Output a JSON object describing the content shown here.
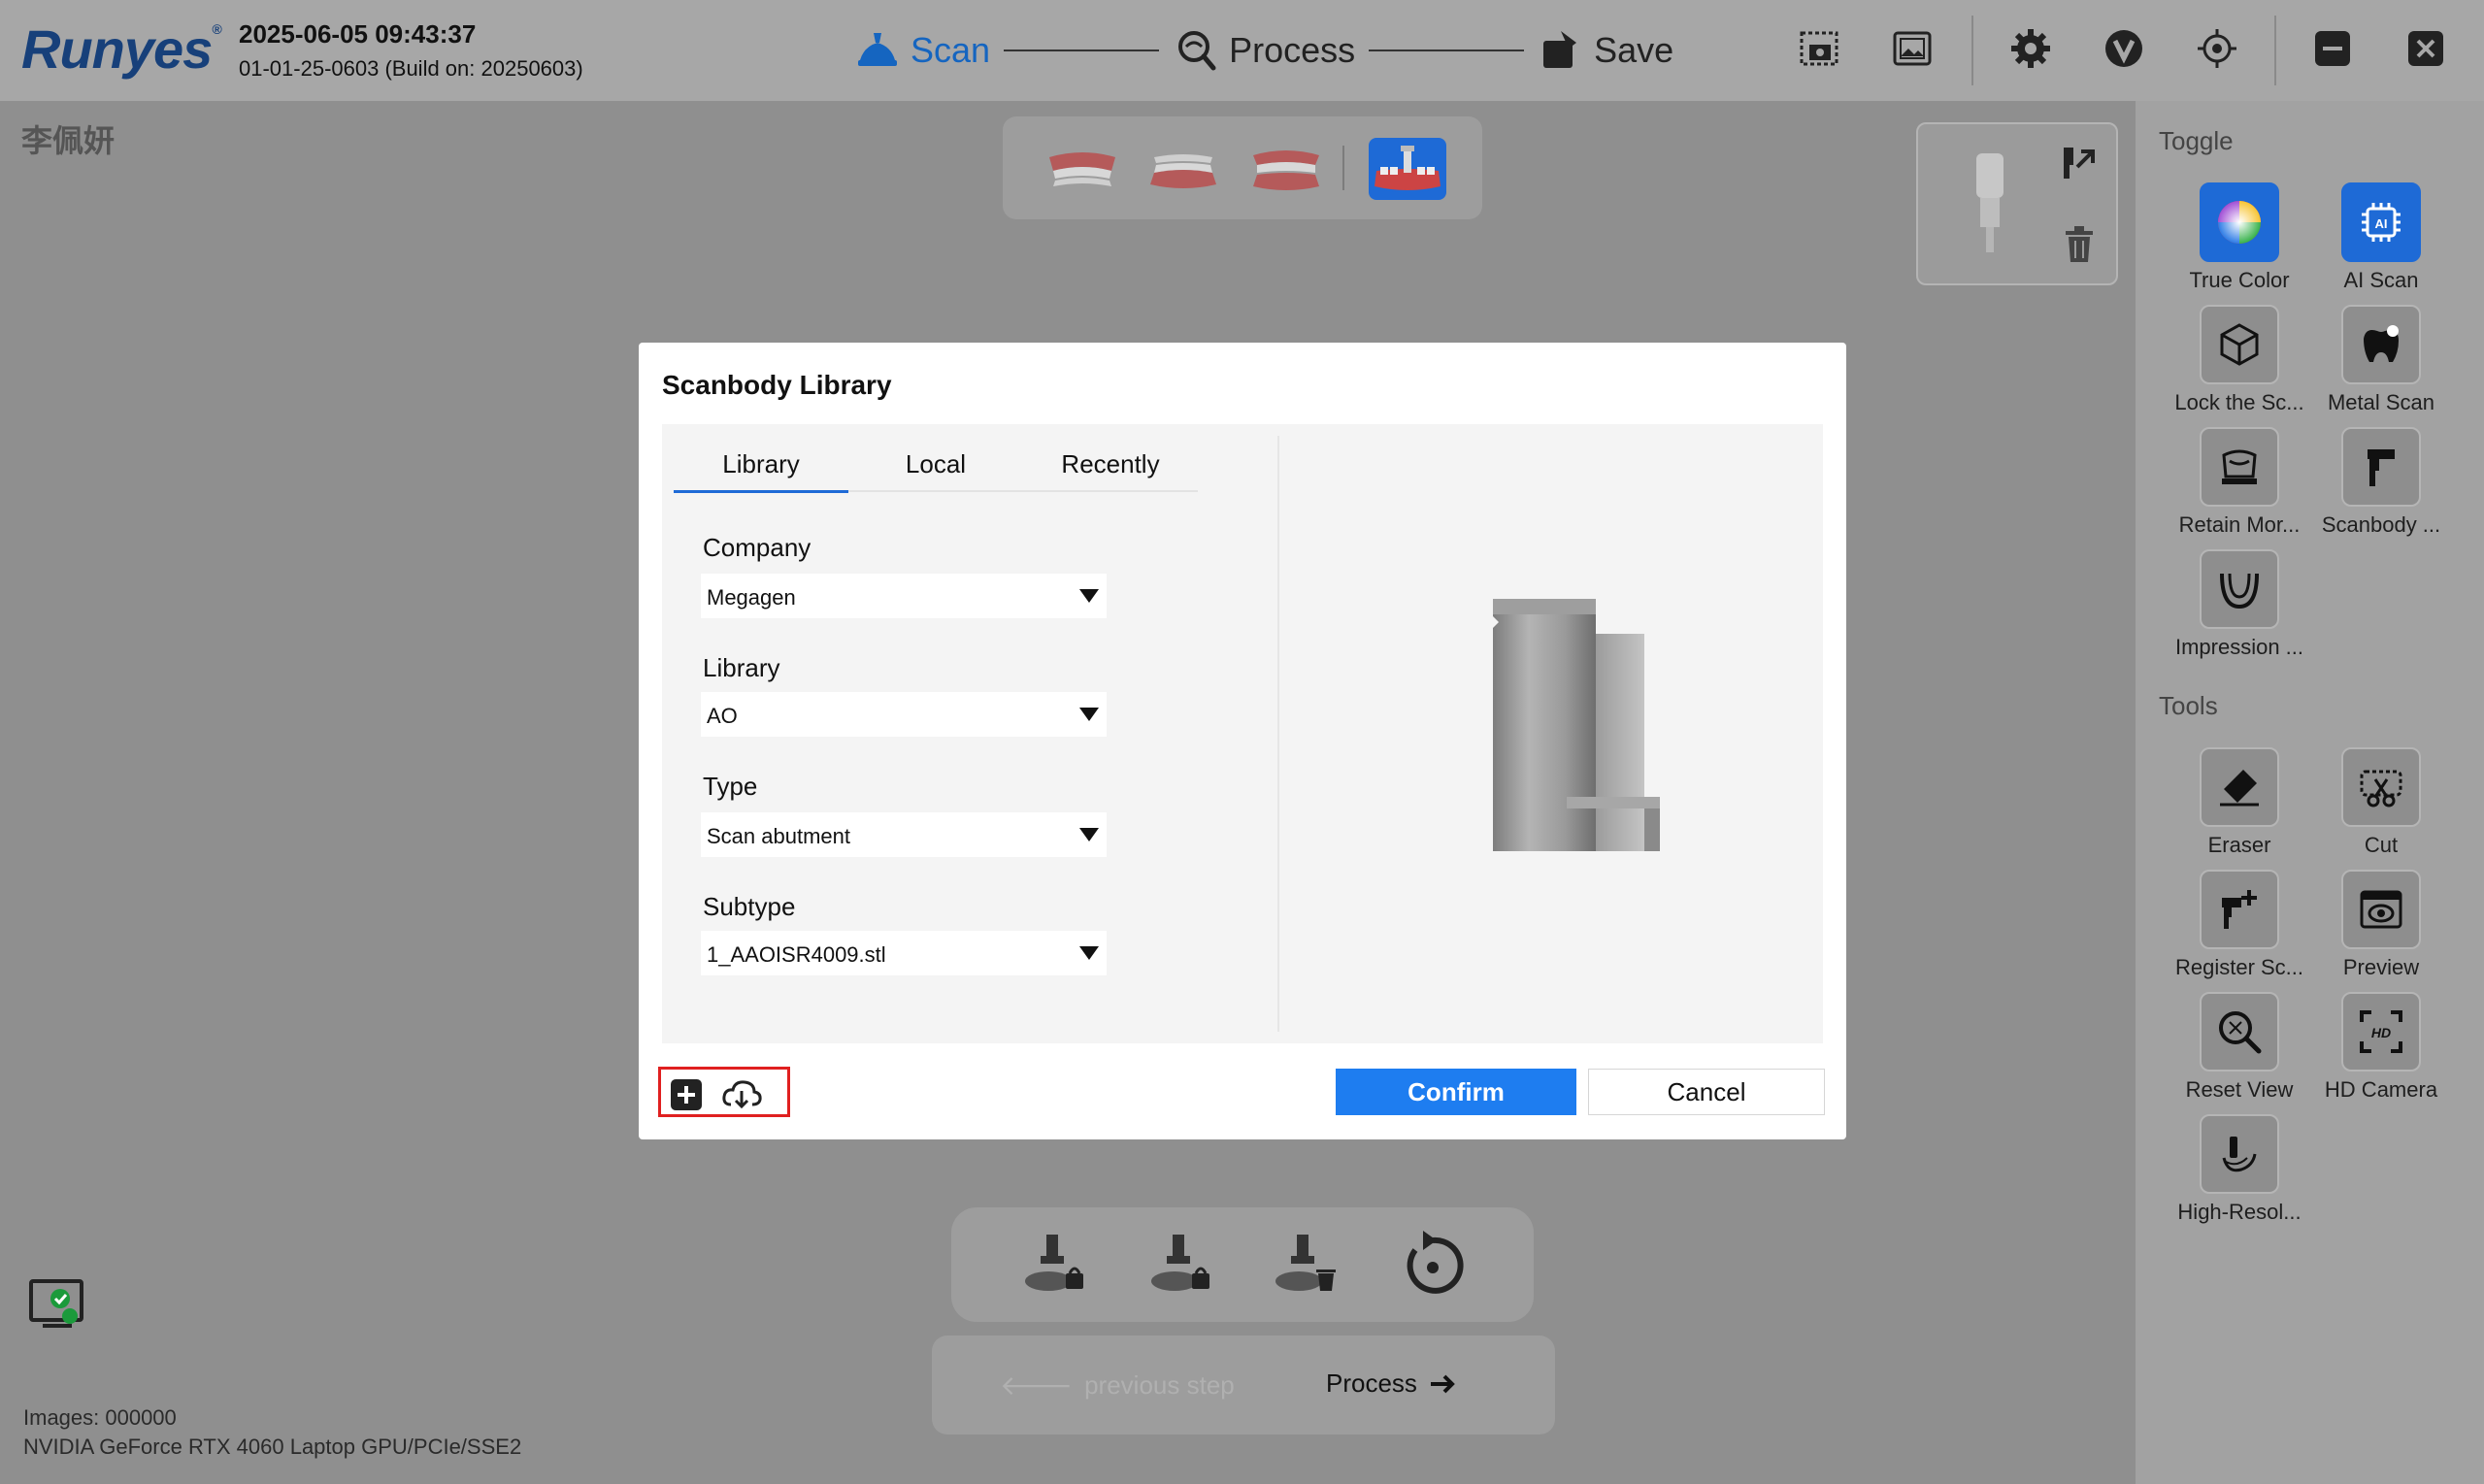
{
  "header": {
    "logo": "Runyes",
    "logo_mark": "®",
    "datetime": "2025-06-05 09:43:37",
    "build": "01-01-25-0603 (Build on: 20250603)",
    "steps": [
      {
        "label": "Scan",
        "active": true
      },
      {
        "label": "Process",
        "active": false
      },
      {
        "label": "Save",
        "active": false
      }
    ],
    "icons": [
      "screenshot-icon",
      "gallery-icon",
      "settings-icon",
      "v-logo-icon",
      "target-icon",
      "minimize-icon",
      "close-icon"
    ]
  },
  "patient_name": "李佩妍",
  "status": {
    "images": "Images: 000000",
    "gpu": "NVIDIA GeForce RTX 4060 Laptop GPU/PCIe/SSE2"
  },
  "sidebar": {
    "toggle_title": "Toggle",
    "toggles": [
      {
        "label": "True Color",
        "icon": "color-wheel-icon",
        "active": true
      },
      {
        "label": "AI Scan",
        "icon": "ai-chip-icon",
        "active": true
      },
      {
        "label": "Lock the Sc...",
        "icon": "cube-icon",
        "active": false
      },
      {
        "label": "Metal Scan",
        "icon": "metal-tooth-icon",
        "active": false
      },
      {
        "label": "Retain Mor...",
        "icon": "retain-tooth-icon",
        "active": false
      },
      {
        "label": "Scanbody ...",
        "icon": "scanbody-icon",
        "active": false
      },
      {
        "label": "Impression ...",
        "icon": "impression-icon",
        "active": false
      }
    ],
    "tools_title": "Tools",
    "tools": [
      {
        "label": "Eraser",
        "icon": "eraser-icon"
      },
      {
        "label": "Cut",
        "icon": "cut-icon"
      },
      {
        "label": "Register Sc...",
        "icon": "register-scanbody-icon"
      },
      {
        "label": "Preview",
        "icon": "preview-icon"
      },
      {
        "label": "Reset View",
        "icon": "reset-view-icon"
      },
      {
        "label": "HD Camera",
        "icon": "hd-camera-icon"
      },
      {
        "label": "High-Resol...",
        "icon": "high-resolution-icon"
      }
    ]
  },
  "navigation": {
    "previous": "previous step",
    "next": "Process"
  },
  "modal": {
    "title": "Scanbody Library",
    "tabs": [
      {
        "label": "Library",
        "active": true
      },
      {
        "label": "Local",
        "active": false
      },
      {
        "label": "Recently",
        "active": false
      }
    ],
    "fields": [
      {
        "label": "Company",
        "value": "Megagen"
      },
      {
        "label": "Library",
        "value": "AO"
      },
      {
        "label": "Type",
        "value": "Scan abutment"
      },
      {
        "label": "Subtype",
        "value": "1_AAOISR4009.stl"
      }
    ],
    "confirm": "Confirm",
    "cancel": "Cancel"
  },
  "colors": {
    "accent": "#1e6ad6",
    "confirm": "#1e7df0",
    "highlight_border": "#e02020"
  }
}
